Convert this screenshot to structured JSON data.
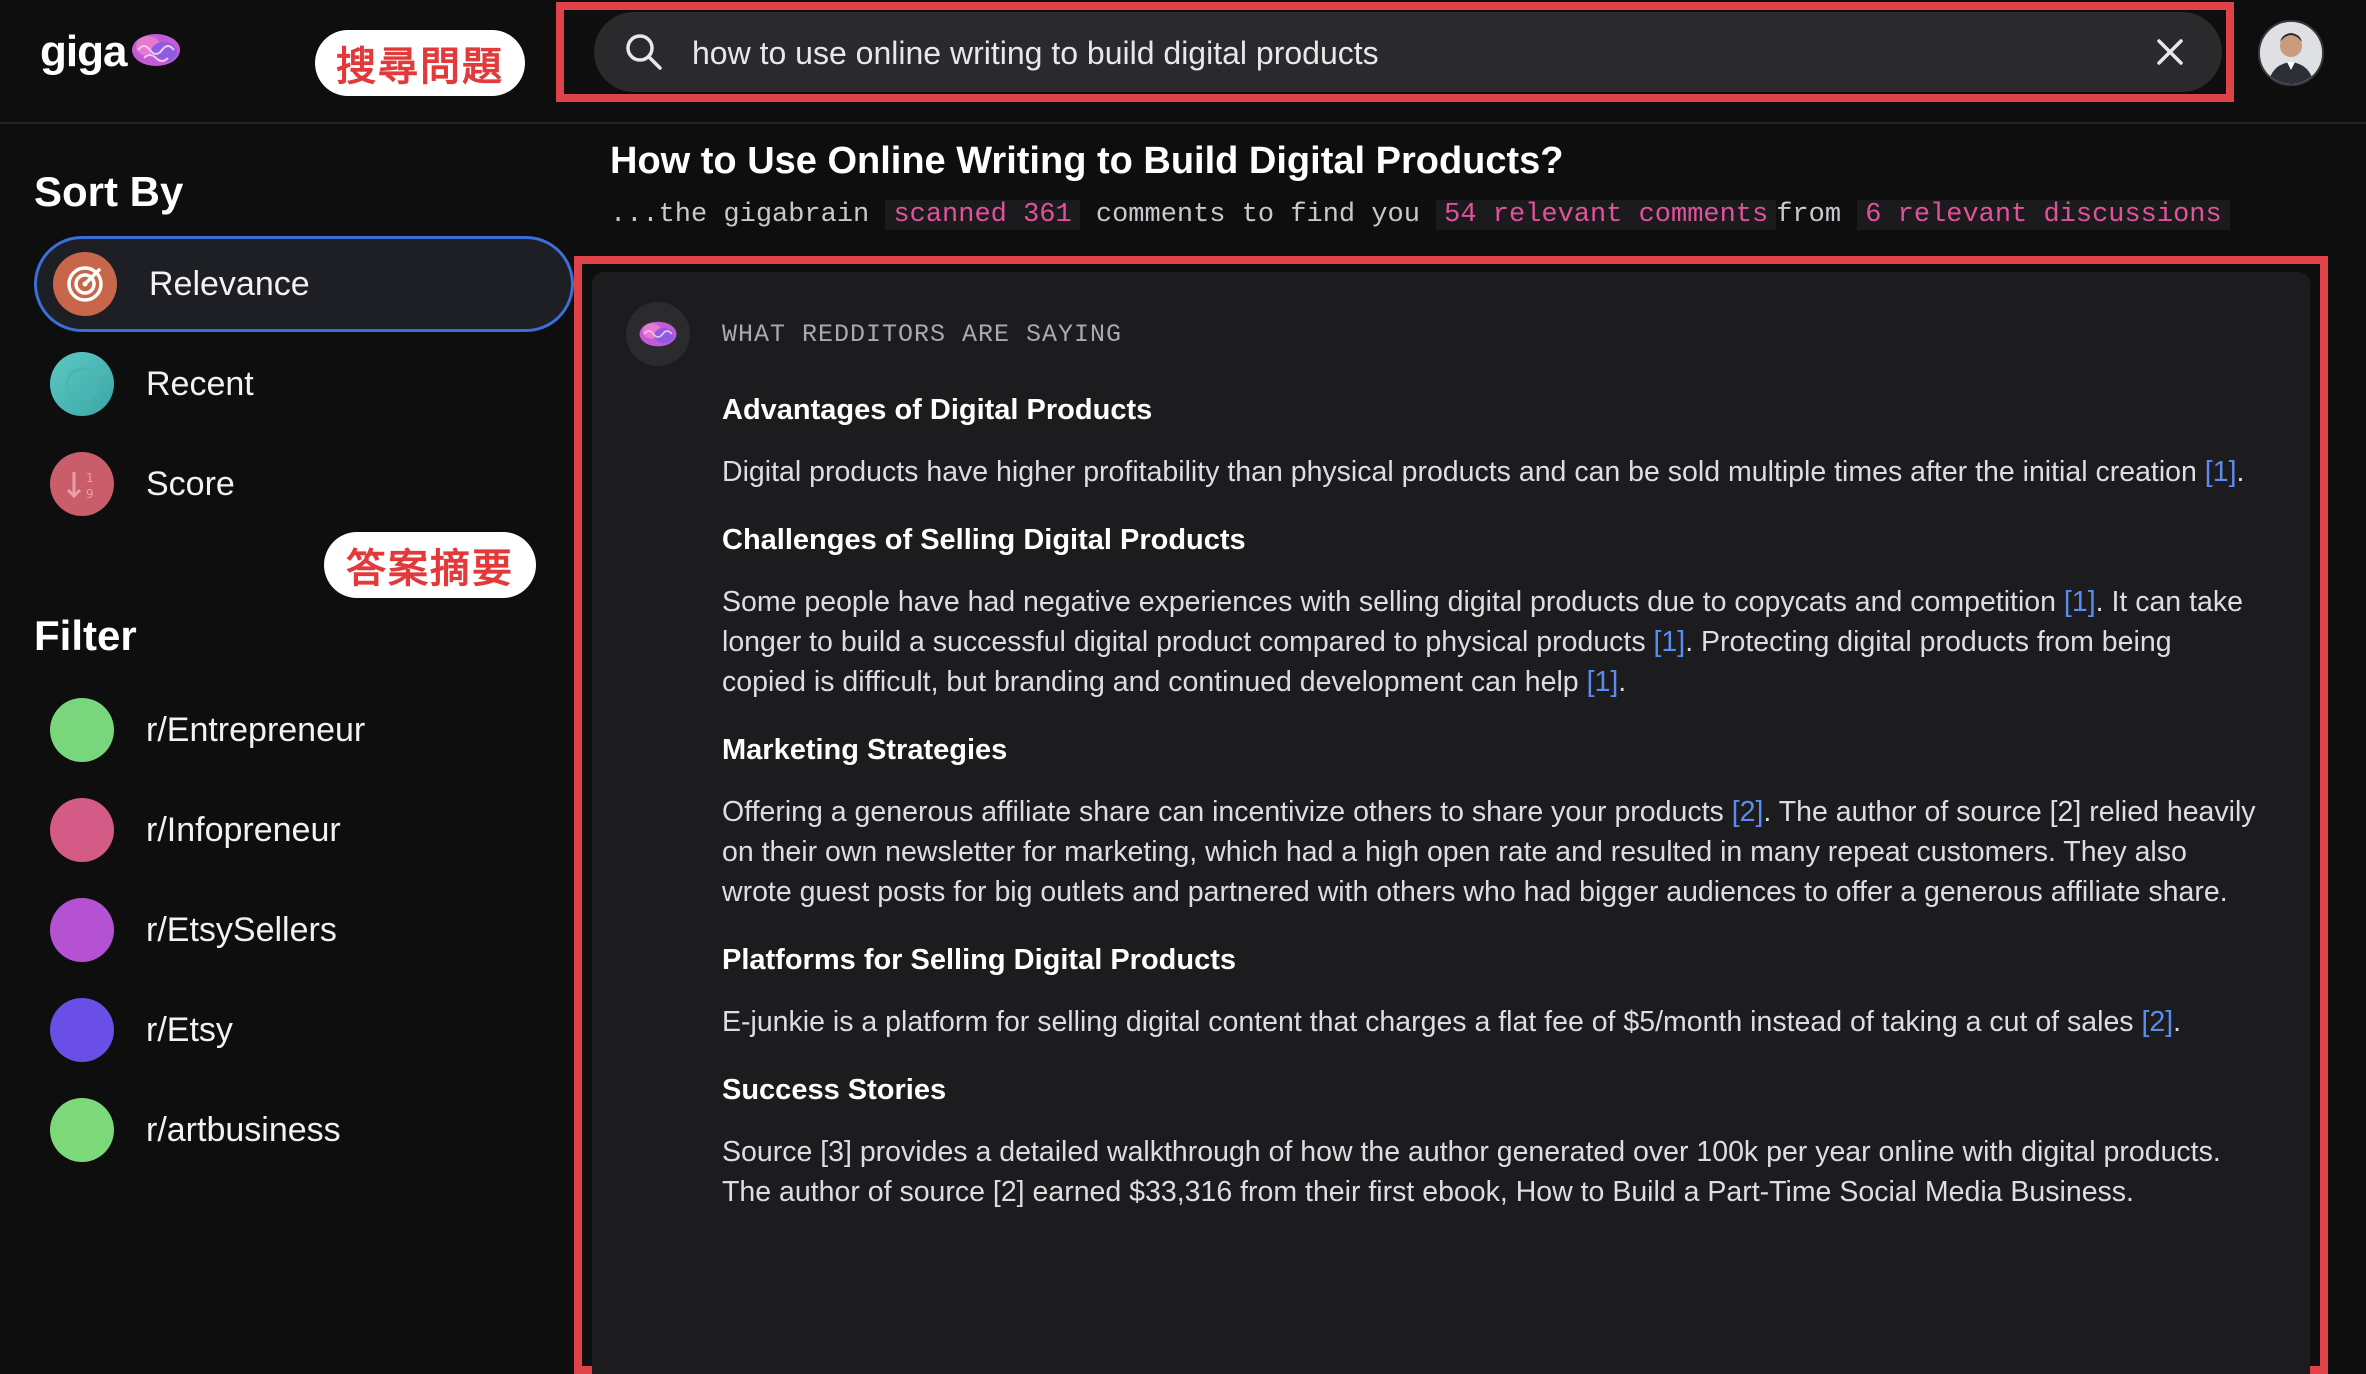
{
  "header": {
    "logo_text": "giga",
    "search_value": "how to use online writing to build digital products",
    "callout_search": "搜尋問題",
    "callout_summary": "答案摘要"
  },
  "sidebar": {
    "sort_heading": "Sort By",
    "sort_items": [
      {
        "label": "Relevance",
        "icon": "target-icon",
        "active": true
      },
      {
        "label": "Recent",
        "icon": "clock-icon",
        "active": false
      },
      {
        "label": "Score",
        "icon": "sort-score-icon",
        "active": false
      }
    ],
    "filter_heading": "Filter",
    "filter_items": [
      {
        "label": "r/Entrepreneur",
        "color": "#7ad67c"
      },
      {
        "label": "r/Infopreneur",
        "color": "#d45b86"
      },
      {
        "label": "r/EtsySellers",
        "color": "#b552d3"
      },
      {
        "label": "r/Etsy",
        "color": "#6a4fe6"
      },
      {
        "label": "r/artbusiness",
        "color": "#7dd87a"
      }
    ]
  },
  "main": {
    "title": "How to Use Online Writing to Build Digital Products?",
    "meta": {
      "prefix": "...the gigabrain ",
      "scanned": "scanned 361",
      "mid": " comments to find you ",
      "relevant_comments": "54 relevant comments",
      "from": "from ",
      "relevant_discussions": "6 relevant discussions"
    },
    "card_label": "WHAT REDDITORS ARE SAYING",
    "sections": [
      {
        "title": "Advantages of Digital Products",
        "parts": [
          {
            "t": "Digital products have higher profitability than physical products and can be sold multiple times after the initial creation "
          },
          {
            "c": "[1]"
          },
          {
            "t": "."
          }
        ]
      },
      {
        "title": "Challenges of Selling Digital Products",
        "parts": [
          {
            "t": "Some people have had negative experiences with selling digital products due to copycats and competition "
          },
          {
            "c": "[1]"
          },
          {
            "t": ". It can take longer to build a successful digital product compared to physical products "
          },
          {
            "c": "[1]"
          },
          {
            "t": ". Protecting digital products from being copied is difficult, but branding and continued development can help "
          },
          {
            "c": "[1]"
          },
          {
            "t": "."
          }
        ]
      },
      {
        "title": "Marketing Strategies",
        "parts": [
          {
            "t": "Offering a generous affiliate share can incentivize others to share your products "
          },
          {
            "c": "[2]"
          },
          {
            "t": ". The author of source [2] relied heavily on their own newsletter for marketing, which had a high open rate and resulted in many repeat customers. They also wrote guest posts for big outlets and partnered with others who had bigger audiences to offer a generous affiliate share."
          }
        ]
      },
      {
        "title": "Platforms for Selling Digital Products",
        "parts": [
          {
            "t": "E-junkie is a platform for selling digital content that charges a flat fee of $5/month instead of taking a cut of sales "
          },
          {
            "c": "[2]"
          },
          {
            "t": "."
          }
        ]
      },
      {
        "title": "Success Stories",
        "parts": [
          {
            "t": "Source [3] provides a detailed walkthrough of how the author generated over 100k per year online with digital products. The author of source [2] earned $33,316 from their first ebook, How to Build a Part-Time Social Media Business."
          }
        ]
      }
    ]
  },
  "colors": {
    "highlight_frame": "#e0424a",
    "accent_pink": "#e2519b",
    "citation_blue": "#5b8cf0",
    "active_border": "#3b6fd8"
  }
}
